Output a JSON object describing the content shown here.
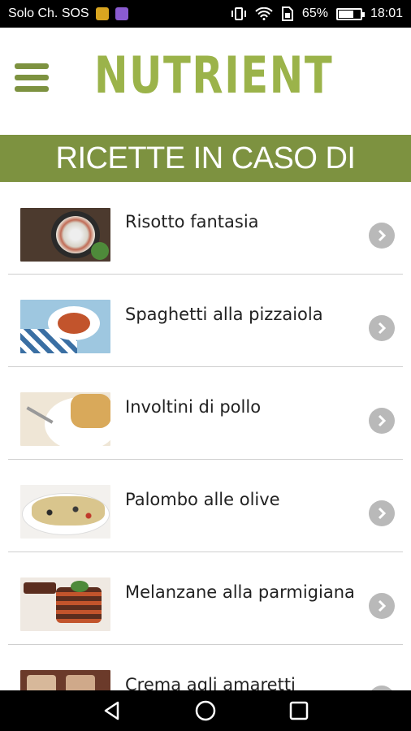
{
  "status_bar": {
    "carrier": "Solo Ch. SOS",
    "battery_text": "65%",
    "battery_level": 0.65,
    "time": "18:01"
  },
  "header": {
    "brand": "NUTRIENT",
    "brand_color": "#9bb34a",
    "accent_color": "#7d9240"
  },
  "banner": {
    "title": "RICETTE IN CASO DI"
  },
  "recipes": [
    {
      "title": "Risotto fantasia"
    },
    {
      "title": "Spaghetti alla pizzaiola"
    },
    {
      "title": "Involtini di pollo"
    },
    {
      "title": "Palombo alle olive"
    },
    {
      "title": "Melanzane alla parmigiana"
    },
    {
      "title": "Crema agli amaretti"
    }
  ]
}
